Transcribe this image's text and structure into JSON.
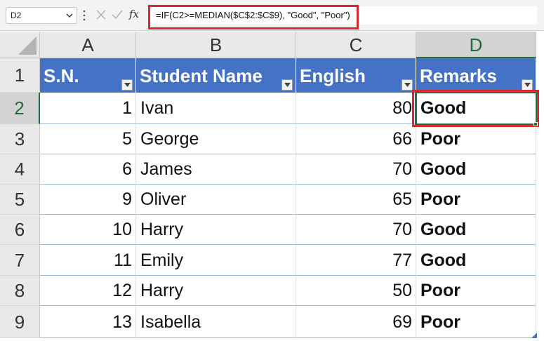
{
  "formula_bar": {
    "name_box": "D2",
    "fx_label": "fx",
    "formula": "=IF(C2>=MEDIAN($C$2:$C$9), \"Good\", \"Poor\")"
  },
  "sheet": {
    "columns": [
      "A",
      "B",
      "C",
      "D"
    ],
    "rows": [
      "1",
      "2",
      "3",
      "4",
      "5",
      "6",
      "7",
      "8",
      "9"
    ],
    "selected_column": "D",
    "selected_row": "2",
    "table_header": [
      "S.N.",
      "Student Name",
      "English",
      "Remarks"
    ],
    "table_rows": [
      [
        "1",
        "Ivan",
        "80",
        "Good"
      ],
      [
        "5",
        "George",
        "66",
        "Poor"
      ],
      [
        "6",
        "James",
        "70",
        "Good"
      ],
      [
        "9",
        "Oliver",
        "65",
        "Poor"
      ],
      [
        "10",
        "Harry",
        "70",
        "Good"
      ],
      [
        "11",
        "Emily",
        "77",
        "Good"
      ],
      [
        "12",
        "Harry",
        "50",
        "Poor"
      ],
      [
        "13",
        "Isabella",
        "69",
        "Poor"
      ]
    ]
  },
  "colors": {
    "table_header": "#4472c4",
    "highlight": "#d9272e",
    "selection": "#217346"
  }
}
